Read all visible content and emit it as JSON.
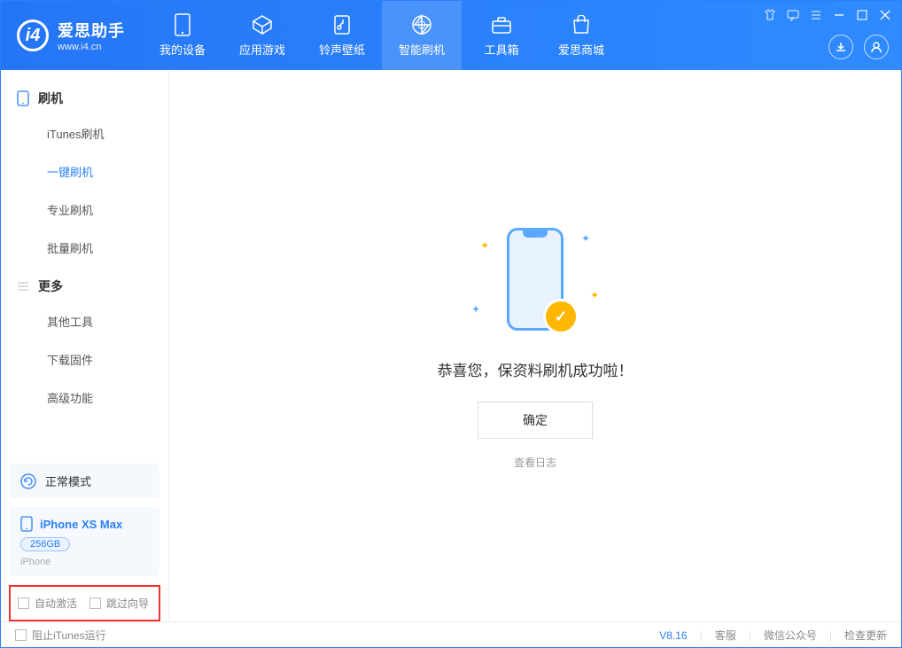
{
  "header": {
    "logo_title": "爱思助手",
    "logo_sub": "www.i4.cn",
    "nav": [
      {
        "label": "我的设备",
        "icon": "device-icon"
      },
      {
        "label": "应用游戏",
        "icon": "apps-icon"
      },
      {
        "label": "铃声壁纸",
        "icon": "ringtone-icon"
      },
      {
        "label": "智能刷机",
        "icon": "flash-icon",
        "active": true
      },
      {
        "label": "工具箱",
        "icon": "toolbox-icon"
      },
      {
        "label": "爱思商城",
        "icon": "store-icon"
      }
    ]
  },
  "sidebar": {
    "section1_title": "刷机",
    "items1": [
      {
        "label": "iTunes刷机"
      },
      {
        "label": "一键刷机",
        "active": true
      },
      {
        "label": "专业刷机"
      },
      {
        "label": "批量刷机"
      }
    ],
    "section2_title": "更多",
    "items2": [
      {
        "label": "其他工具"
      },
      {
        "label": "下载固件"
      },
      {
        "label": "高级功能"
      }
    ],
    "mode_label": "正常模式",
    "device_name": "iPhone XS Max",
    "device_capacity": "256GB",
    "device_type": "iPhone",
    "opt_auto_activate": "自动激活",
    "opt_skip_guide": "跳过向导"
  },
  "main": {
    "success_msg": "恭喜您，保资料刷机成功啦！",
    "ok_btn": "确定",
    "view_log": "查看日志"
  },
  "footer": {
    "block_itunes": "阻止iTunes运行",
    "version": "V8.16",
    "service": "客服",
    "wechat": "微信公众号",
    "check_update": "检查更新"
  }
}
